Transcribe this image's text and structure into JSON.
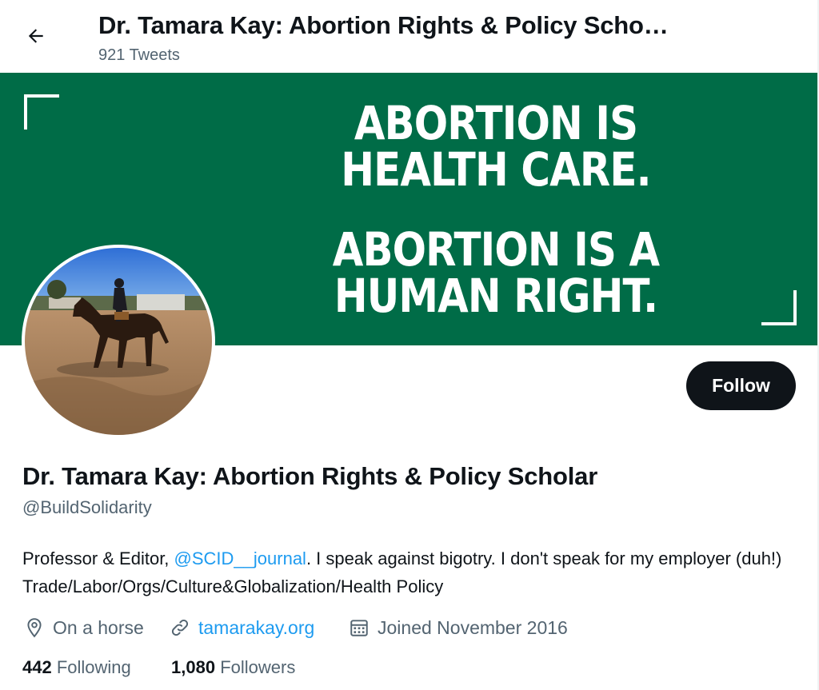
{
  "header": {
    "title": "Dr. Tamara Kay: Abortion Rights & Policy Scho…",
    "tweet_count": "921 Tweets"
  },
  "banner": {
    "line1": "ABORTION IS",
    "line2": "HEALTH CARE.",
    "line3": "ABORTION IS A",
    "line4": "HUMAN RIGHT.",
    "background_color": "#006c47"
  },
  "profile": {
    "display_name": "Dr. Tamara Kay: Abortion Rights & Policy Scholar",
    "handle": "@BuildSolidarity",
    "bio_prefix": "Professor & Editor, ",
    "bio_mention": "@SCID__journal",
    "bio_suffix": ". I speak against bigotry. I don't speak for my employer (duh!) Trade/Labor/Orgs/Culture&Globalization/Health Policy",
    "location": "On a horse",
    "website": "tamarakay.org",
    "joined": "Joined November 2016"
  },
  "stats": {
    "following_count": "442",
    "following_label": "Following",
    "followers_count": "1,080",
    "followers_label": "Followers"
  },
  "actions": {
    "follow_label": "Follow"
  },
  "icons": {
    "back": "arrow-left-icon",
    "location": "location-pin-icon",
    "link": "link-icon",
    "calendar": "calendar-icon"
  },
  "colors": {
    "accent": "#1d9bf0",
    "text": "#0f1419",
    "secondary_text": "#536471",
    "button_bg": "#0f1419"
  }
}
